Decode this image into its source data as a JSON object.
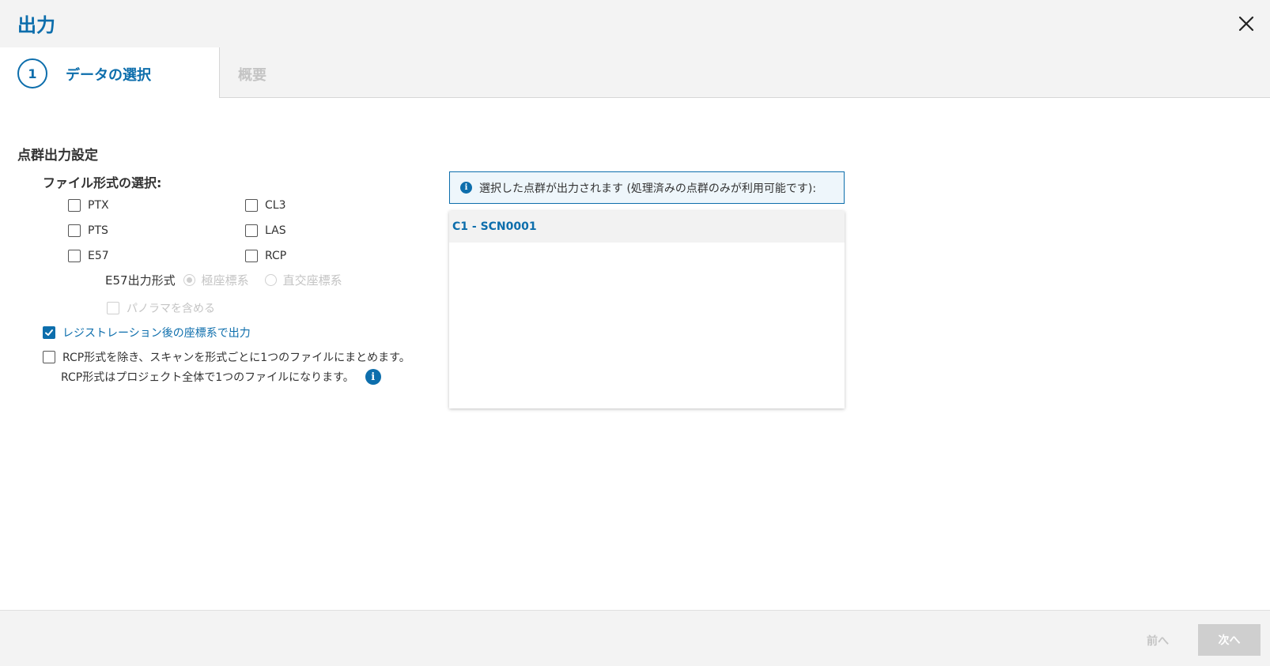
{
  "window": {
    "title": "出力"
  },
  "steps": [
    {
      "number": "1",
      "label": "データの選択"
    },
    {
      "label": "概要"
    }
  ],
  "settings": {
    "section_title": "点群出力設定",
    "format_heading": "ファイル形式の選択:",
    "formats": {
      "ptx": "PTX",
      "pts": "PTS",
      "e57": "E57",
      "cl3": "CL3",
      "las": "LAS",
      "rcp": "RCP"
    },
    "e57_format_label": "E57出力形式",
    "e57_options": [
      "極座標系",
      "直交座標系"
    ],
    "include_panorama": "パノラマを含める",
    "registration_output": "レジストレーション後の座標系で出力",
    "merge_option_line1": "RCP形式を除き、スキャンを形式ごとに1つのファイルにまとめます。",
    "merge_option_line2": "RCP形式はプロジェクト全体で1つのファイルになります。"
  },
  "selection": {
    "info_text": "選択した点群が出力されます (処理済みの点群のみが利用可能です):",
    "items": [
      "C1 - SCN0001"
    ]
  },
  "footer": {
    "prev_label": "前へ",
    "next_label": "次へ"
  },
  "colors": {
    "accent": "#0d6eac",
    "disabled": "#c4c4c4",
    "header_bg": "#f3f3f3"
  },
  "icons": {
    "close": "close-icon",
    "info": "info-icon",
    "check": "checkmark-icon"
  }
}
